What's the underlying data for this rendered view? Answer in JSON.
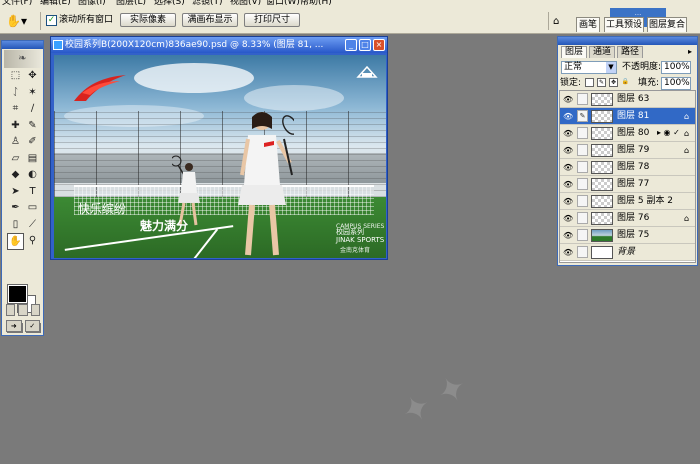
{
  "menu": [
    "文件(F)",
    "编辑(E)",
    "图像(I)",
    "图层(L)",
    "选择(S)",
    "滤镜(T)",
    "视图(V)",
    "窗口(W)",
    "帮助(H)"
  ],
  "options": {
    "scroll_all_label": "滚动所有窗口",
    "scroll_all_checked": "✓",
    "btn_actual_pixels": "实际像素",
    "btn_fit_screen": "满画布显示",
    "btn_print_size": "打印尺寸",
    "tabs": [
      "画笔",
      "工具预设",
      "图层复合"
    ],
    "top_badge": "..."
  },
  "document": {
    "title": "校园系列B(200X120cm)836ae90.psd @ 8.33% (图层 81, ...",
    "canvas": {
      "slogan_line1": "快乐缤纷",
      "slogan_line2": "魅力满分",
      "brand_sub": "CAMPUS SERIES",
      "brand_cn": "校园系列",
      "brand_en": "JINAK SPORTS",
      "brand_bottom": "金南克体育"
    }
  },
  "layers_panel": {
    "tabs": [
      "图层",
      "通道",
      "路径"
    ],
    "blend_mode": "正常",
    "opacity_label": "不透明度:",
    "opacity_value": "100%",
    "lock_label": "锁定:",
    "fill_label": "填充:",
    "fill_value": "100%",
    "rows": [
      {
        "name": "图层 63"
      },
      {
        "name": "图层 81"
      },
      {
        "name": "图层 80"
      },
      {
        "name": "图层 79"
      },
      {
        "name": "图层 78"
      },
      {
        "name": "图层 77"
      },
      {
        "name": "图层 5 副本 2"
      },
      {
        "name": "图层 76"
      },
      {
        "name": "图层 75"
      },
      {
        "name": "背景"
      }
    ],
    "selected_index": 1
  },
  "colors": {
    "title_blue": "#2858c8",
    "selected_row": "#3169c6",
    "workspace": "#7a7a7a"
  }
}
